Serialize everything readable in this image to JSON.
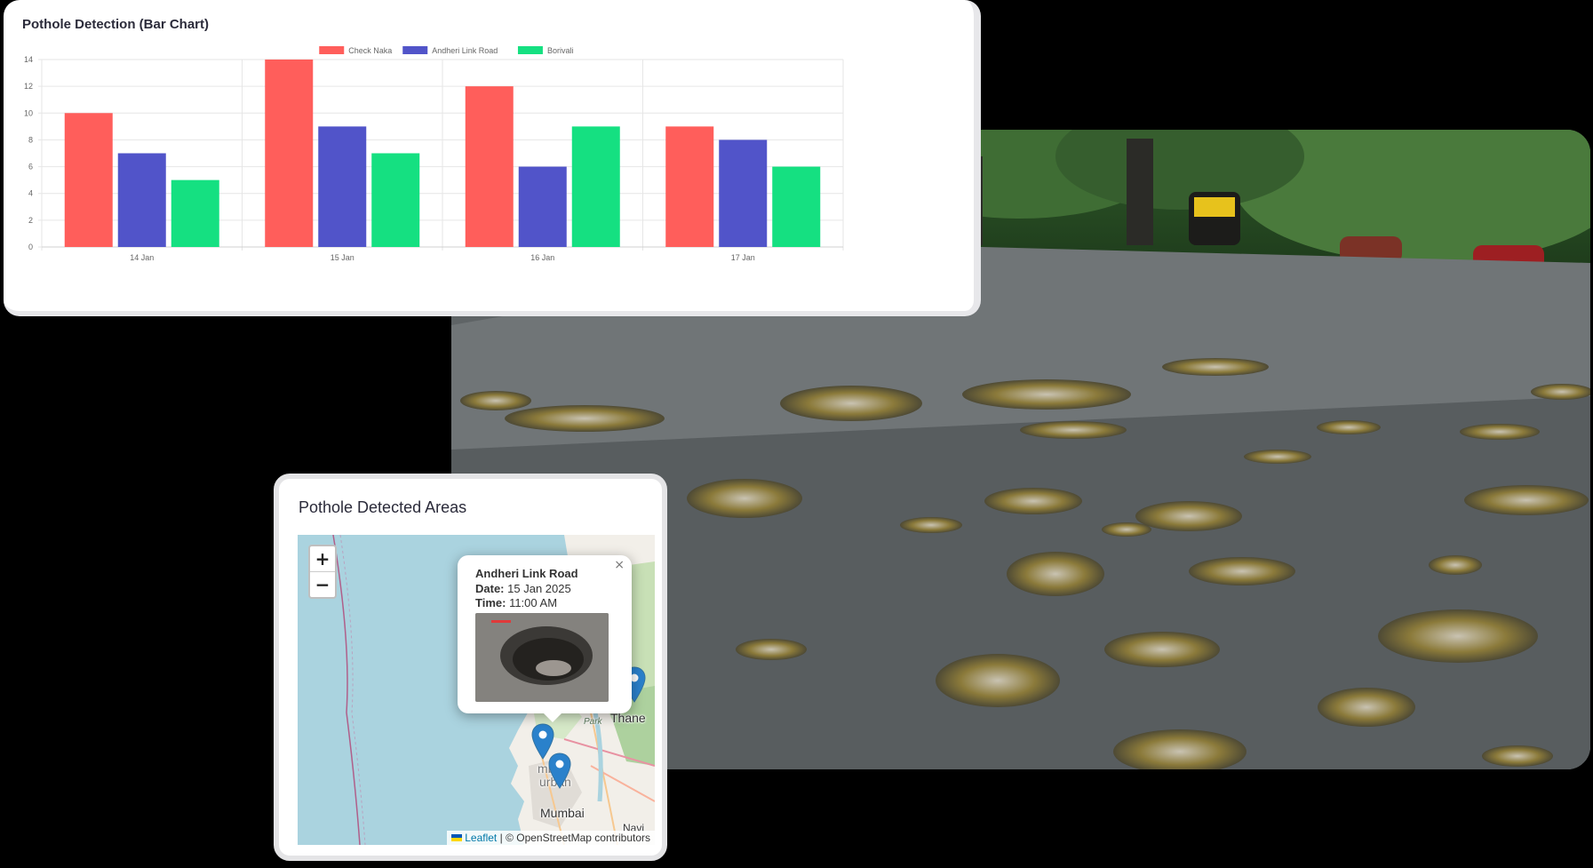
{
  "chart_card": {
    "title": "Pothole Detection (Bar Chart)"
  },
  "chart_data": {
    "type": "bar",
    "categories": [
      "14 Jan",
      "15 Jan",
      "16 Jan",
      "17 Jan"
    ],
    "series": [
      {
        "name": "Check Naka",
        "color": "#ff5e5b",
        "values": [
          10,
          14,
          12,
          9
        ]
      },
      {
        "name": "Andheri Link Road",
        "color": "#5154c9",
        "values": [
          7,
          9,
          6,
          8
        ]
      },
      {
        "name": "Borivali",
        "color": "#15e081",
        "values": [
          5,
          7,
          9,
          6
        ]
      }
    ],
    "yticks": [
      0,
      2,
      4,
      6,
      8,
      10,
      12,
      14
    ],
    "ylim": [
      0,
      14
    ],
    "grid": true,
    "legend": "top-center"
  },
  "map_card": {
    "title": "Pothole Detected Areas",
    "zoom_in": "+",
    "zoom_out": "−",
    "popup": {
      "close": "×",
      "location": "Andheri Link Road",
      "date_label": "Date:",
      "date": "15 Jan 2025",
      "time_label": "Time:",
      "time": "11:00 AM"
    },
    "labels": {
      "thane": "Thane",
      "mumbai": "Mumbai",
      "park": "Park",
      "navi": "Navi",
      "mbai": "mbai",
      "urban": "urban"
    },
    "attribution": {
      "leaflet": "Leaflet",
      "separator": "|",
      "osm": "© OpenStreetMap contributors"
    },
    "marker_color": "#2a81cb"
  }
}
